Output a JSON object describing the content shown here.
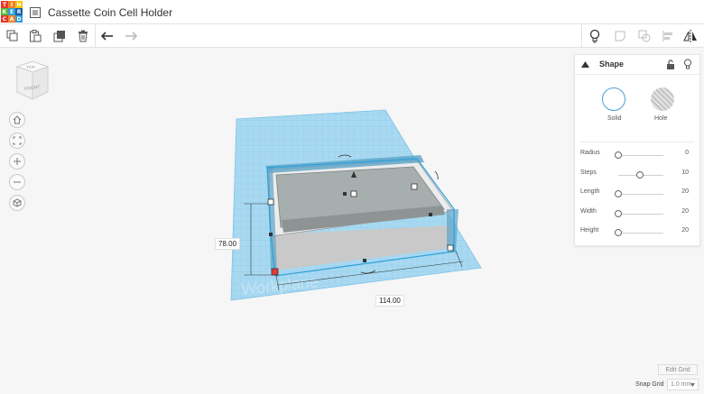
{
  "app": {
    "logo_letters": [
      "T",
      "I",
      "N",
      "K",
      "E",
      "R",
      "C",
      "A",
      "D"
    ],
    "logo_colors": [
      "#e8372d",
      "#f08226",
      "#f6c400",
      "#5cb73a",
      "#2d9fd9",
      "#1a5fa8",
      "#e8372d",
      "#f08226",
      "#2d9fd9"
    ],
    "document_title": "Cassette Coin Cell Holder"
  },
  "toolbar": {
    "left_icons": [
      "copy-icon",
      "paste-icon",
      "duplicate-icon",
      "trash-icon",
      "undo-icon",
      "redo-icon"
    ],
    "right_icons": [
      "lightbulb-icon",
      "note-icon",
      "group-icon",
      "align-icon",
      "mirror-icon"
    ]
  },
  "viewcube": {
    "top_label": "TOP",
    "front_label": "FRONT"
  },
  "view_controls": [
    "home-view-icon",
    "fit-view-icon",
    "zoom-in-icon",
    "zoom-out-icon",
    "perspective-icon"
  ],
  "workplane": {
    "label": "Workplane"
  },
  "dimensions": {
    "depth": "78.00",
    "width": "114.00"
  },
  "shape_panel": {
    "title": "Shape",
    "solid_label": "Solid",
    "hole_label": "Hole",
    "params": [
      {
        "label": "Radius",
        "value": "0",
        "fill": 0.0
      },
      {
        "label": "Steps",
        "value": "10",
        "fill": 0.47
      },
      {
        "label": "Length",
        "value": "20",
        "fill": 0.0
      },
      {
        "label": "Width",
        "value": "20",
        "fill": 0.0
      },
      {
        "label": "Height",
        "value": "20",
        "fill": 0.0
      }
    ]
  },
  "bottom": {
    "edit_grid": "Edit Grid",
    "snap_grid_label": "Snap Grid",
    "snap_grid_value": "1.0 mm"
  },
  "colors": {
    "accent": "#2d9fd9",
    "workplane": "#9fd3ee",
    "grid_line": "#7cc2e6",
    "shape": "#d8d8d8",
    "selection": "#2d9fd9"
  }
}
